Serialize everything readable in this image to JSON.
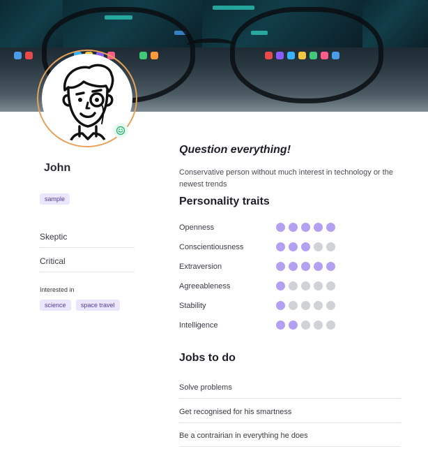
{
  "banner": {
    "description_icon": "glasses-desk-photo"
  },
  "profile": {
    "name": "John",
    "avatar_icon": "cartoon-man-monocle-avatar",
    "mood_icon": "smile-icon",
    "tag": "sample",
    "attributes": [
      "Skeptic",
      "Critical"
    ],
    "interests_label": "Interested in",
    "interests": [
      "science",
      "space travel"
    ]
  },
  "quote": "Question everything!",
  "description": "Conservative person without much interest in technology or the newest trends",
  "traits": {
    "title": "Personality traits",
    "max": 5,
    "items": [
      {
        "label": "Openness",
        "value": 5
      },
      {
        "label": "Conscientiousness",
        "value": 3
      },
      {
        "label": "Extraversion",
        "value": 5
      },
      {
        "label": "Agreeableness",
        "value": 1
      },
      {
        "label": "Stability",
        "value": 1
      },
      {
        "label": "Intelligence",
        "value": 2
      }
    ]
  },
  "jobs": {
    "title": "Jobs to do",
    "items": [
      "Solve problems",
      "Get recognised for his smartness",
      "Be a contrairian in everything he does"
    ]
  },
  "colors": {
    "accent": "#b3a0f1",
    "inactive": "#cfd2d6",
    "tag_bg": "#ebe6fb",
    "ring": "#e8a15a"
  }
}
